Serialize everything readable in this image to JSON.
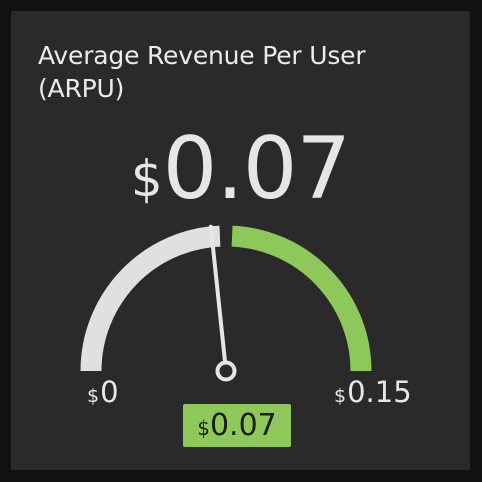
{
  "panel": {
    "title": "Average Revenue Per User (ARPU)",
    "value_currency": "$",
    "value_number": "0.07"
  },
  "gauge": {
    "min": 0,
    "max": 0.15,
    "value": 0.07,
    "threshold": 0.075,
    "min_label_currency": "$",
    "min_label_number": "0",
    "max_label_currency": "$",
    "max_label_number": "0.15",
    "badge_currency": "$",
    "badge_number": "0.07",
    "colors": {
      "base": "#e0e0e0",
      "threshold": "#8fc85a",
      "needle": "#e6e6e6",
      "badge": "#8fc85a"
    }
  }
}
